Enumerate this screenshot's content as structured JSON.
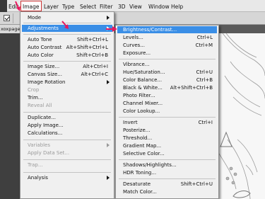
{
  "menubar": {
    "items": [
      "Edit",
      "Image",
      "Layer",
      "Type",
      "Select",
      "Filter",
      "3D",
      "View",
      "Window",
      "Help"
    ]
  },
  "tab": {
    "label": "xoxpage"
  },
  "image_menu": {
    "items": [
      {
        "label": "Mode",
        "shortcut": "",
        "submenu": true,
        "disabled": false
      },
      {
        "label": "Adjustments",
        "shortcut": "",
        "submenu": true,
        "disabled": false,
        "highlight": true
      },
      {
        "label": "Auto Tone",
        "shortcut": "Shift+Ctrl+L",
        "disabled": false
      },
      {
        "label": "Auto Contrast",
        "shortcut": "Alt+Shift+Ctrl+L",
        "disabled": false
      },
      {
        "label": "Auto Color",
        "shortcut": "Shift+Ctrl+B",
        "disabled": false
      },
      {
        "label": "Image Size...",
        "shortcut": "Alt+Ctrl+I",
        "disabled": false
      },
      {
        "label": "Canvas Size...",
        "shortcut": "Alt+Ctrl+C",
        "disabled": false
      },
      {
        "label": "Image Rotation",
        "shortcut": "",
        "submenu": true,
        "disabled": false
      },
      {
        "label": "Crop",
        "shortcut": "",
        "disabled": true
      },
      {
        "label": "Trim...",
        "shortcut": "",
        "disabled": false
      },
      {
        "label": "Reveal All",
        "shortcut": "",
        "disabled": true
      },
      {
        "label": "Duplicate...",
        "shortcut": "",
        "disabled": false
      },
      {
        "label": "Apply Image...",
        "shortcut": "",
        "disabled": false
      },
      {
        "label": "Calculations...",
        "shortcut": "",
        "disabled": false
      },
      {
        "label": "Variables",
        "shortcut": "",
        "submenu": true,
        "disabled": true
      },
      {
        "label": "Apply Data Set...",
        "shortcut": "",
        "disabled": true
      },
      {
        "label": "Trap...",
        "shortcut": "",
        "disabled": true
      },
      {
        "label": "Analysis",
        "shortcut": "",
        "submenu": true,
        "disabled": false
      }
    ]
  },
  "adjustments_menu": {
    "items": [
      {
        "label": "Brightness/Contrast...",
        "shortcut": "",
        "highlight": true
      },
      {
        "label": "Levels...",
        "shortcut": "Ctrl+L"
      },
      {
        "label": "Curves...",
        "shortcut": "Ctrl+M"
      },
      {
        "label": "Exposure...",
        "shortcut": ""
      },
      {
        "label": "Vibrance...",
        "shortcut": ""
      },
      {
        "label": "Hue/Saturation...",
        "shortcut": "Ctrl+U"
      },
      {
        "label": "Color Balance...",
        "shortcut": "Ctrl+B"
      },
      {
        "label": "Black & White...",
        "shortcut": "Alt+Shift+Ctrl+B"
      },
      {
        "label": "Photo Filter...",
        "shortcut": ""
      },
      {
        "label": "Channel Mixer...",
        "shortcut": ""
      },
      {
        "label": "Color Lookup...",
        "shortcut": ""
      },
      {
        "label": "Invert",
        "shortcut": "Ctrl+I"
      },
      {
        "label": "Posterize...",
        "shortcut": ""
      },
      {
        "label": "Threshold...",
        "shortcut": ""
      },
      {
        "label": "Gradient Map...",
        "shortcut": ""
      },
      {
        "label": "Selective Color...",
        "shortcut": ""
      },
      {
        "label": "Shadows/Highlights...",
        "shortcut": ""
      },
      {
        "label": "HDR Toning...",
        "shortcut": ""
      },
      {
        "label": "Desaturate",
        "shortcut": "Shift+Ctrl+U"
      },
      {
        "label": "Match Color...",
        "shortcut": ""
      }
    ]
  },
  "colors": {
    "highlight": "#3a8ee6",
    "annotation_arrow": "#e8175d",
    "active_menu_border": "#cc3333"
  },
  "icons": [
    "checkbox-icon",
    "submenu-arrow-icon",
    "annotation-arrow"
  ]
}
